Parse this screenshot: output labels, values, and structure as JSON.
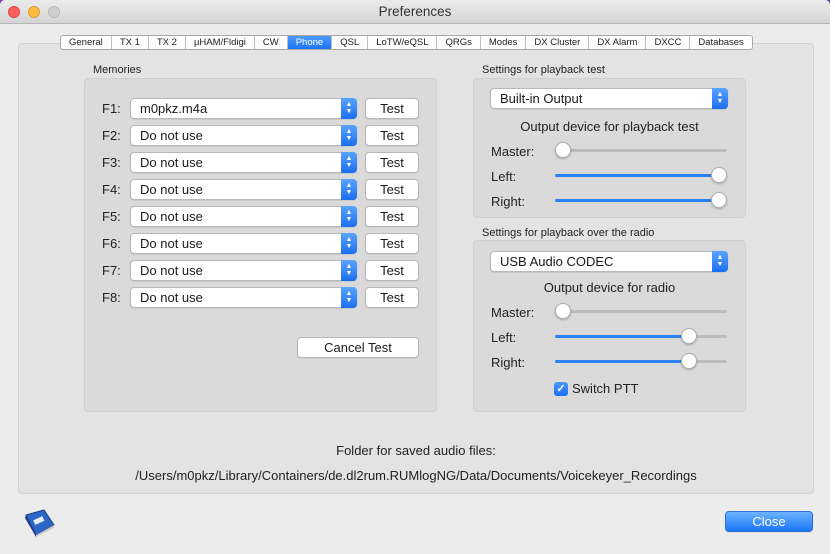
{
  "window": {
    "title": "Preferences"
  },
  "tabs": [
    "General",
    "TX 1",
    "TX 2",
    "µHAM/Fldigi",
    "CW",
    "Phone",
    "QSL",
    "LoTW/eQSL",
    "QRGs",
    "Modes",
    "DX Cluster",
    "DX Alarm",
    "DXCC",
    "Databases"
  ],
  "active_tab": "Phone",
  "memories": {
    "label": "Memories",
    "test_label": "Test",
    "rows": [
      {
        "key": "F1:",
        "value": "m0pkz.m4a"
      },
      {
        "key": "F2:",
        "value": "Do not use"
      },
      {
        "key": "F3:",
        "value": "Do not use"
      },
      {
        "key": "F4:",
        "value": "Do not use"
      },
      {
        "key": "F5:",
        "value": "Do not use"
      },
      {
        "key": "F6:",
        "value": "Do not use"
      },
      {
        "key": "F7:",
        "value": "Do not use"
      },
      {
        "key": "F8:",
        "value": "Do not use"
      }
    ],
    "cancel_test_label": "Cancel Test"
  },
  "playback_test": {
    "label": "Settings for playback test",
    "device": "Built-in Output",
    "device_caption": "Output device for playback test",
    "master_label": "Master:",
    "left_label": "Left:",
    "right_label": "Right:",
    "master_level": 0.0,
    "left_level": 1.0,
    "right_level": 1.0
  },
  "playback_radio": {
    "label": "Settings for playback over the radio",
    "device": "USB Audio CODEC",
    "device_caption": "Output device for radio",
    "master_label": "Master:",
    "left_label": "Left:",
    "right_label": "Right:",
    "master_level": 0.0,
    "left_level": 0.77,
    "right_level": 0.77,
    "switch_ptt_label": "Switch PTT",
    "switch_ptt_checked": true
  },
  "folder": {
    "label": "Folder for saved audio files:",
    "path": "/Users/m0pkz/Library/Containers/de.dl2rum.RUMlogNG/Data/Documents/Voicekeyer_Recordings"
  },
  "footer": {
    "close_label": "Close"
  },
  "colors": {
    "accent": "#1b6ff2",
    "background": "#ececec"
  }
}
